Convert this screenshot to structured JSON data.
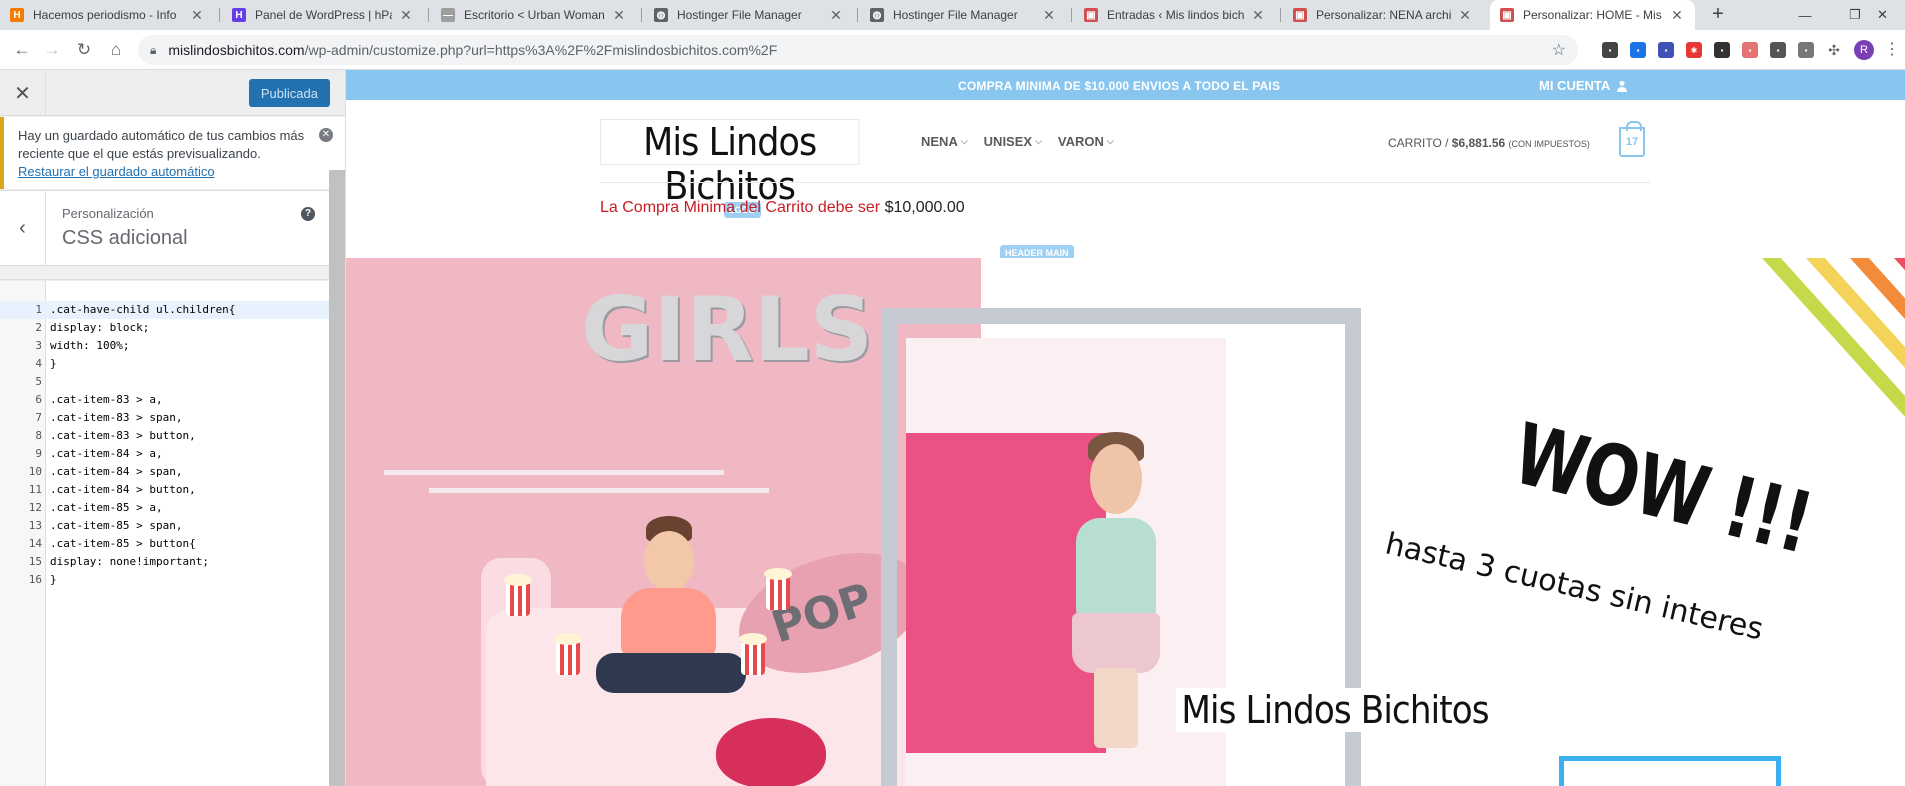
{
  "browser": {
    "tabs": [
      {
        "title": "Hacemos periodismo - Info",
        "favicon": "hostinger-icon",
        "color": "#f57c00",
        "glyph": "H"
      },
      {
        "title": "Panel de WordPress | hPane",
        "favicon": "hpanel-icon",
        "color": "#673de6",
        "glyph": "H"
      },
      {
        "title": "Escritorio < Urban Woman",
        "favicon": "urban-woman-icon",
        "color": "#9e9e9e",
        "glyph": "—"
      },
      {
        "title": "Hostinger File Manager",
        "favicon": "globe-icon",
        "color": "#5f6368",
        "glyph": "◍"
      },
      {
        "title": "Hostinger File Manager",
        "favicon": "globe-icon",
        "color": "#5f6368",
        "glyph": "◍"
      },
      {
        "title": "Entradas ‹ Mis lindos bichit",
        "favicon": "mis-lindos-bichitos-icon",
        "color": "#d05050",
        "glyph": "▣"
      },
      {
        "title": "Personalizar: NENA archivo",
        "favicon": "mis-lindos-bichitos-icon",
        "color": "#d05050",
        "glyph": "▣"
      },
      {
        "title": "Personalizar: HOME - Mis li",
        "favicon": "mis-lindos-bichitos-icon",
        "color": "#d05050",
        "glyph": "▣"
      }
    ],
    "url_host": "mislindosbichitos.com",
    "url_path": "/wp-admin/customize.php?url=https%3A%2F%2Fmislindosbichitos.com%2F",
    "profile_initial": "R"
  },
  "customizer": {
    "publish_label": "Publicada",
    "notice_text": "Hay un guardado automático de tus cambios más reciente que el que estás previsualizando.",
    "notice_link": "Restaurar el guardado automático",
    "section_crumb": "Personalización",
    "section_title": "CSS adicional",
    "code_lines": [
      ".cat-have-child ul.children{",
      "display: block;",
      "width: 100%;",
      "}",
      "",
      ".cat-item-83 > a,",
      ".cat-item-83 > span,",
      ".cat-item-83 > button,",
      ".cat-item-84 > a,",
      ".cat-item-84 > span,",
      ".cat-item-84 > button,",
      ".cat-item-85 > a,",
      ".cat-item-85 > span,",
      ".cat-item-85 > button{",
      "display: none!important;",
      "}"
    ]
  },
  "site": {
    "promo": "COMPRA MINIMA DE $10.000 ENVIOS A TODO EL PAIS",
    "account": "MI CUENTA",
    "logo_text": "Mis Lindos Bichitos",
    "logo_tip": "LOGO",
    "header_tip": "HEADER MAIN",
    "nav": [
      "NENA",
      "UNISEX",
      "VARON"
    ],
    "cart_label": "CARRITO /",
    "cart_amount": "$6,881.56",
    "cart_tax": "(CON IMPUESTOS)",
    "cart_count": "17",
    "min_notice": "La Compra Minima del Carrito debe ser",
    "min_amount": "$10,000.00"
  },
  "hero": {
    "balloon_text": "GIRLS",
    "pinata_text": "POP",
    "wow": "WOW !!!",
    "cuotas": "hasta 3 cuotas sin interes",
    "brand": "Mis Lindos Bichitos",
    "stripe_colors": [
      "#c6d94a",
      "#f4d35a",
      "#f28b3a",
      "#ee4e62",
      "#d64774",
      "#e7a3b8"
    ]
  }
}
